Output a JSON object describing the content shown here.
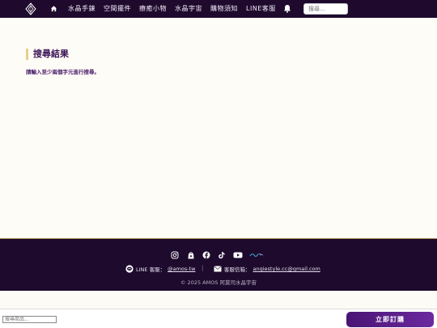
{
  "nav": {
    "items": [
      {
        "label": "水晶手鍊"
      },
      {
        "label": "空間擺件"
      },
      {
        "label": "療癒小物"
      },
      {
        "label": "水晶宇宙"
      },
      {
        "label": "購物須知"
      },
      {
        "label": "LINE客服"
      }
    ],
    "search_placeholder": "搜尋..."
  },
  "main": {
    "title": "搜尋結果",
    "message": "請輸入至少兩個字元進行搜尋。"
  },
  "footer": {
    "line_label": "LINE 客服：",
    "line_id": "@amos-tw",
    "separator": "|",
    "email_label": "客服信箱：",
    "email": "angiestyle.cc@gmail.com",
    "copyright": "© 2025 AMOS 阿莫司水晶宇宙"
  },
  "bottom": {
    "product_search_placeholder": "搜尋商品...",
    "subscribe_label": "立即訂購"
  },
  "colors": {
    "nav_bg": "#1f0a2e",
    "accent_gold": "#e8cf8a",
    "title_purple": "#3b1456"
  }
}
